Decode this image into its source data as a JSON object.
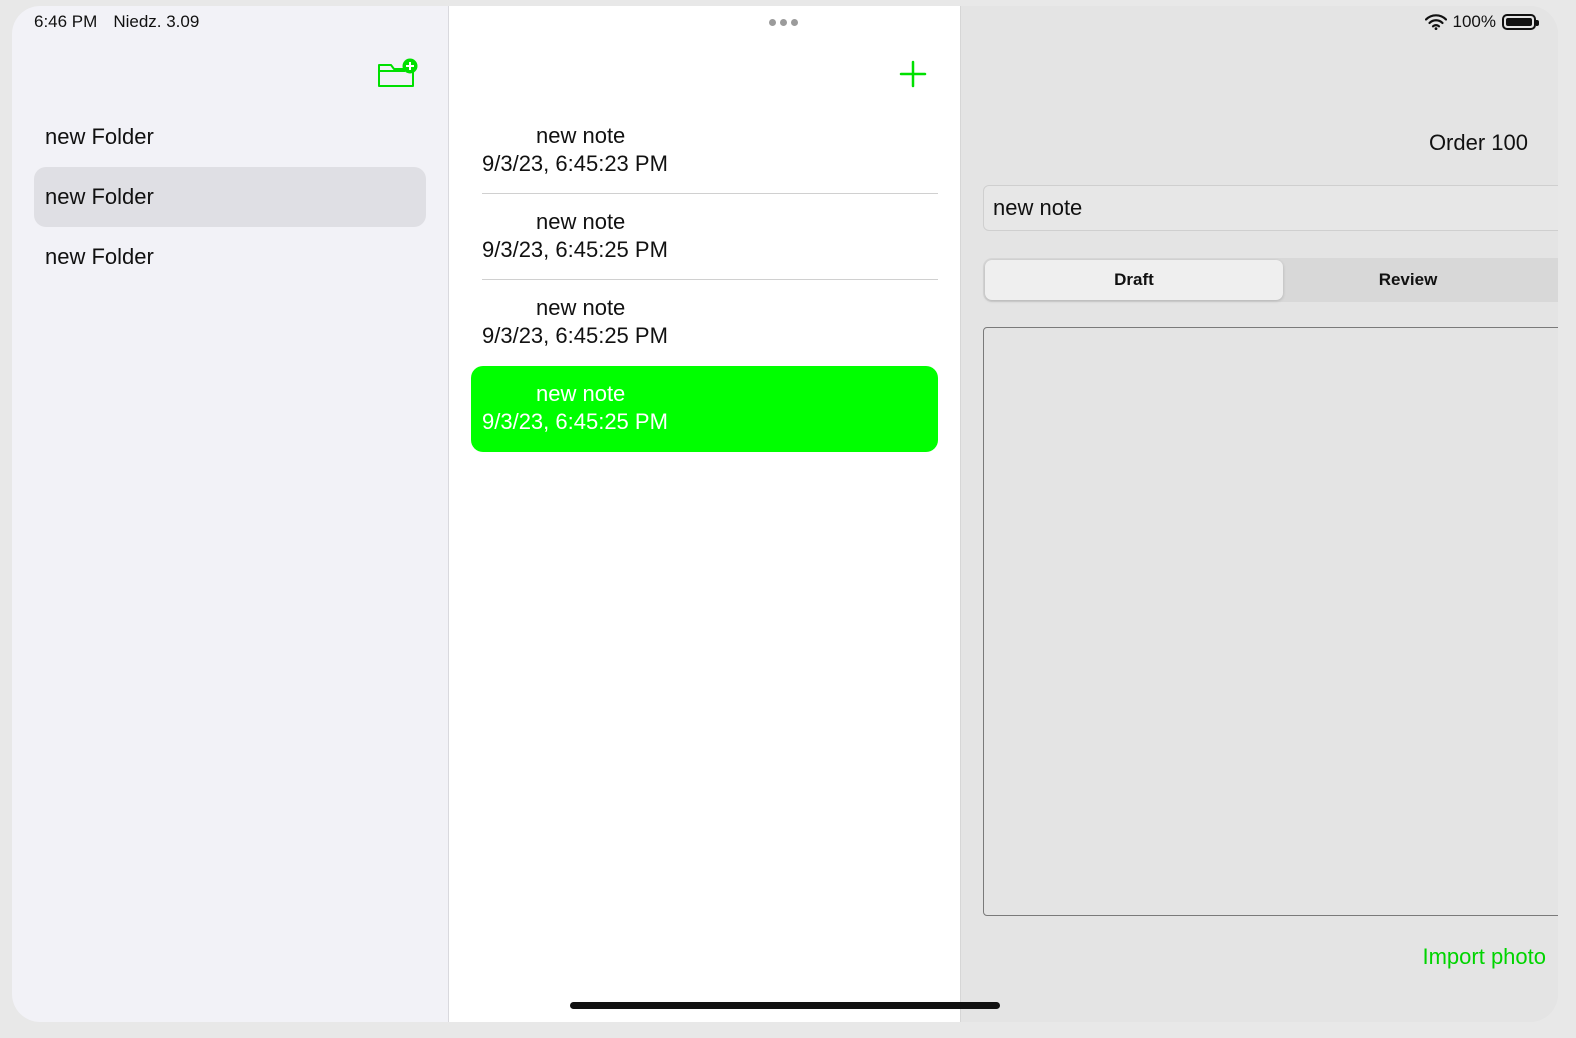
{
  "status_bar": {
    "time": "6:46 PM",
    "date": "Niedz. 3.09",
    "battery": "100%"
  },
  "sidebar": {
    "new_folder_icon": "folder-badge-plus-icon",
    "folders": [
      {
        "label": "new Folder",
        "selected": false
      },
      {
        "label": "new Folder",
        "selected": true
      },
      {
        "label": "new Folder",
        "selected": false
      }
    ]
  },
  "notes_list": {
    "add_icon": "plus-icon",
    "notes": [
      {
        "title": "new note",
        "date": "9/3/23, 6:45:23 PM",
        "selected": false
      },
      {
        "title": "new note",
        "date": "9/3/23, 6:45:25 PM",
        "selected": false
      },
      {
        "title": "new note",
        "date": "9/3/23, 6:45:25 PM",
        "selected": false
      },
      {
        "title": "new note",
        "date": "9/3/23, 6:45:25 PM",
        "selected": true
      }
    ]
  },
  "detail": {
    "order_label": "Order 100",
    "title_value": "new note",
    "segments": {
      "draft": "Draft",
      "review": "Review"
    },
    "import_photo": "Import photo"
  },
  "colors": {
    "accent": "#00ff00",
    "accent_text": "#00d400",
    "sidebar_bg": "#f2f2f7",
    "detail_bg": "#e4e4e4"
  }
}
